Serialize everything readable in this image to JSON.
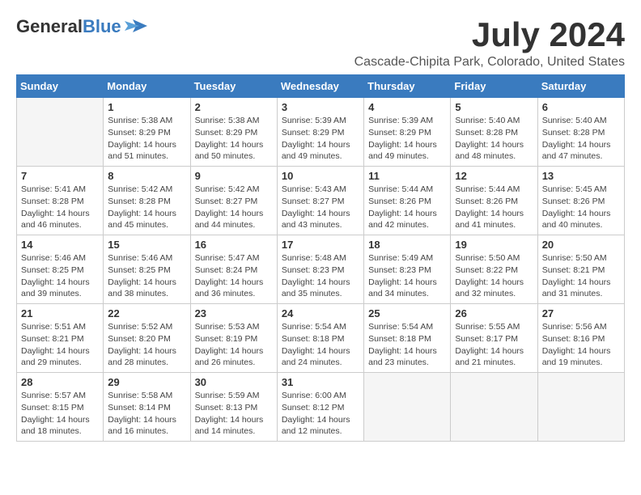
{
  "header": {
    "logo_general": "General",
    "logo_blue": "Blue",
    "month_title": "July 2024",
    "location": "Cascade-Chipita Park, Colorado, United States"
  },
  "days_of_week": [
    "Sunday",
    "Monday",
    "Tuesday",
    "Wednesday",
    "Thursday",
    "Friday",
    "Saturday"
  ],
  "weeks": [
    [
      {
        "date": "",
        "empty": true
      },
      {
        "date": "1",
        "sunrise": "Sunrise: 5:38 AM",
        "sunset": "Sunset: 8:29 PM",
        "daylight": "Daylight: 14 hours and 51 minutes."
      },
      {
        "date": "2",
        "sunrise": "Sunrise: 5:38 AM",
        "sunset": "Sunset: 8:29 PM",
        "daylight": "Daylight: 14 hours and 50 minutes."
      },
      {
        "date": "3",
        "sunrise": "Sunrise: 5:39 AM",
        "sunset": "Sunset: 8:29 PM",
        "daylight": "Daylight: 14 hours and 49 minutes."
      },
      {
        "date": "4",
        "sunrise": "Sunrise: 5:39 AM",
        "sunset": "Sunset: 8:29 PM",
        "daylight": "Daylight: 14 hours and 49 minutes."
      },
      {
        "date": "5",
        "sunrise": "Sunrise: 5:40 AM",
        "sunset": "Sunset: 8:28 PM",
        "daylight": "Daylight: 14 hours and 48 minutes."
      },
      {
        "date": "6",
        "sunrise": "Sunrise: 5:40 AM",
        "sunset": "Sunset: 8:28 PM",
        "daylight": "Daylight: 14 hours and 47 minutes."
      }
    ],
    [
      {
        "date": "7",
        "sunrise": "Sunrise: 5:41 AM",
        "sunset": "Sunset: 8:28 PM",
        "daylight": "Daylight: 14 hours and 46 minutes."
      },
      {
        "date": "8",
        "sunrise": "Sunrise: 5:42 AM",
        "sunset": "Sunset: 8:28 PM",
        "daylight": "Daylight: 14 hours and 45 minutes."
      },
      {
        "date": "9",
        "sunrise": "Sunrise: 5:42 AM",
        "sunset": "Sunset: 8:27 PM",
        "daylight": "Daylight: 14 hours and 44 minutes."
      },
      {
        "date": "10",
        "sunrise": "Sunrise: 5:43 AM",
        "sunset": "Sunset: 8:27 PM",
        "daylight": "Daylight: 14 hours and 43 minutes."
      },
      {
        "date": "11",
        "sunrise": "Sunrise: 5:44 AM",
        "sunset": "Sunset: 8:26 PM",
        "daylight": "Daylight: 14 hours and 42 minutes."
      },
      {
        "date": "12",
        "sunrise": "Sunrise: 5:44 AM",
        "sunset": "Sunset: 8:26 PM",
        "daylight": "Daylight: 14 hours and 41 minutes."
      },
      {
        "date": "13",
        "sunrise": "Sunrise: 5:45 AM",
        "sunset": "Sunset: 8:26 PM",
        "daylight": "Daylight: 14 hours and 40 minutes."
      }
    ],
    [
      {
        "date": "14",
        "sunrise": "Sunrise: 5:46 AM",
        "sunset": "Sunset: 8:25 PM",
        "daylight": "Daylight: 14 hours and 39 minutes."
      },
      {
        "date": "15",
        "sunrise": "Sunrise: 5:46 AM",
        "sunset": "Sunset: 8:25 PM",
        "daylight": "Daylight: 14 hours and 38 minutes."
      },
      {
        "date": "16",
        "sunrise": "Sunrise: 5:47 AM",
        "sunset": "Sunset: 8:24 PM",
        "daylight": "Daylight: 14 hours and 36 minutes."
      },
      {
        "date": "17",
        "sunrise": "Sunrise: 5:48 AM",
        "sunset": "Sunset: 8:23 PM",
        "daylight": "Daylight: 14 hours and 35 minutes."
      },
      {
        "date": "18",
        "sunrise": "Sunrise: 5:49 AM",
        "sunset": "Sunset: 8:23 PM",
        "daylight": "Daylight: 14 hours and 34 minutes."
      },
      {
        "date": "19",
        "sunrise": "Sunrise: 5:50 AM",
        "sunset": "Sunset: 8:22 PM",
        "daylight": "Daylight: 14 hours and 32 minutes."
      },
      {
        "date": "20",
        "sunrise": "Sunrise: 5:50 AM",
        "sunset": "Sunset: 8:21 PM",
        "daylight": "Daylight: 14 hours and 31 minutes."
      }
    ],
    [
      {
        "date": "21",
        "sunrise": "Sunrise: 5:51 AM",
        "sunset": "Sunset: 8:21 PM",
        "daylight": "Daylight: 14 hours and 29 minutes."
      },
      {
        "date": "22",
        "sunrise": "Sunrise: 5:52 AM",
        "sunset": "Sunset: 8:20 PM",
        "daylight": "Daylight: 14 hours and 28 minutes."
      },
      {
        "date": "23",
        "sunrise": "Sunrise: 5:53 AM",
        "sunset": "Sunset: 8:19 PM",
        "daylight": "Daylight: 14 hours and 26 minutes."
      },
      {
        "date": "24",
        "sunrise": "Sunrise: 5:54 AM",
        "sunset": "Sunset: 8:18 PM",
        "daylight": "Daylight: 14 hours and 24 minutes."
      },
      {
        "date": "25",
        "sunrise": "Sunrise: 5:54 AM",
        "sunset": "Sunset: 8:18 PM",
        "daylight": "Daylight: 14 hours and 23 minutes."
      },
      {
        "date": "26",
        "sunrise": "Sunrise: 5:55 AM",
        "sunset": "Sunset: 8:17 PM",
        "daylight": "Daylight: 14 hours and 21 minutes."
      },
      {
        "date": "27",
        "sunrise": "Sunrise: 5:56 AM",
        "sunset": "Sunset: 8:16 PM",
        "daylight": "Daylight: 14 hours and 19 minutes."
      }
    ],
    [
      {
        "date": "28",
        "sunrise": "Sunrise: 5:57 AM",
        "sunset": "Sunset: 8:15 PM",
        "daylight": "Daylight: 14 hours and 18 minutes."
      },
      {
        "date": "29",
        "sunrise": "Sunrise: 5:58 AM",
        "sunset": "Sunset: 8:14 PM",
        "daylight": "Daylight: 14 hours and 16 minutes."
      },
      {
        "date": "30",
        "sunrise": "Sunrise: 5:59 AM",
        "sunset": "Sunset: 8:13 PM",
        "daylight": "Daylight: 14 hours and 14 minutes."
      },
      {
        "date": "31",
        "sunrise": "Sunrise: 6:00 AM",
        "sunset": "Sunset: 8:12 PM",
        "daylight": "Daylight: 14 hours and 12 minutes."
      },
      {
        "date": "",
        "empty": true
      },
      {
        "date": "",
        "empty": true
      },
      {
        "date": "",
        "empty": true
      }
    ]
  ]
}
